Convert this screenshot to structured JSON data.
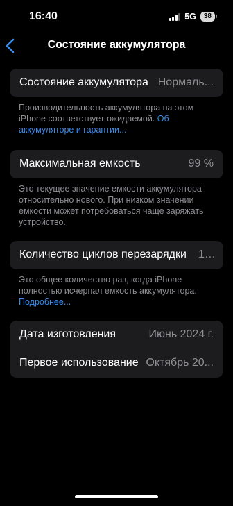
{
  "status_bar": {
    "time": "16:40",
    "network": "5G",
    "battery": "38"
  },
  "nav": {
    "title": "Состояние аккумулятора",
    "back_icon": "chevron-left-icon"
  },
  "battery_health": {
    "label": "Состояние аккумулятора",
    "value": "Нормаль...",
    "footer_text": "Производительность аккумулятора на этом iPhone соответствует ожидаемой. ",
    "footer_link": "Об аккумуляторе и гарантии..."
  },
  "max_capacity": {
    "label": "Максимальная емкость",
    "value": "99 %",
    "footer_text": "Это текущее значение емкости аккумулятора относительно нового. При низком значении емкости может потребоваться чаще заряжать устройство."
  },
  "cycle_count": {
    "label": "Количество циклов перезарядки",
    "value": "1...",
    "footer_text": "Это общее количество раз, когда iPhone полностью исчерпал емкость аккумулятора.",
    "footer_link": "Подробнее..."
  },
  "dates": {
    "manufacture_label": "Дата изготовления",
    "manufacture_value": "Июнь 2024 г.",
    "first_use_label": "Первое использование",
    "first_use_value": "Октябрь 20..."
  },
  "colors": {
    "background": "#000000",
    "card": "#1c1c1e",
    "secondary_text": "#8d8d93",
    "link": "#3a8cf0"
  }
}
